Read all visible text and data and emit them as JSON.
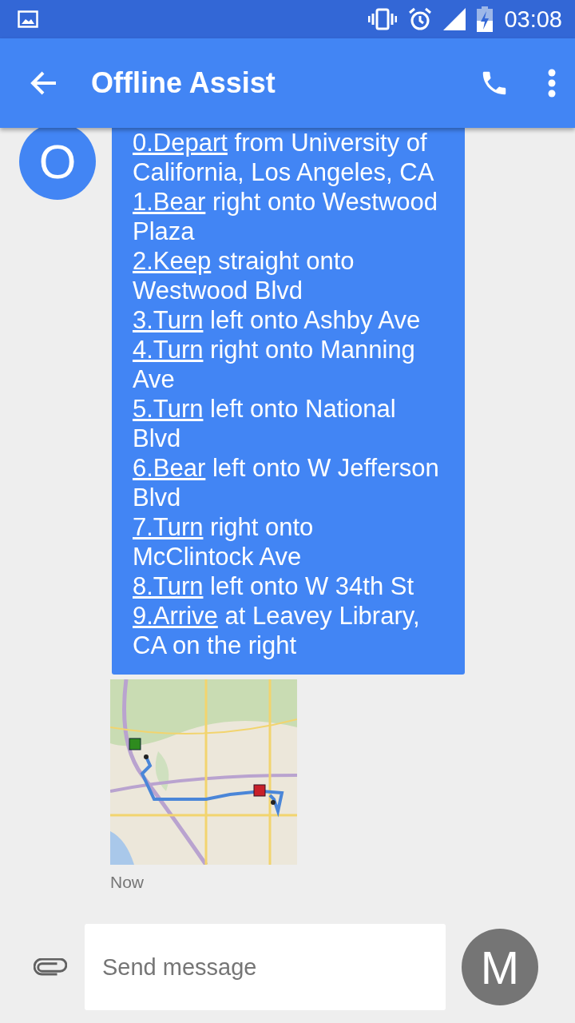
{
  "status_bar": {
    "time": "03:08"
  },
  "app_bar": {
    "title": "Offline Assist"
  },
  "messages": [
    {
      "avatar_letter": "O",
      "steps": [
        {
          "link": "0.Depart",
          "text": "from University of California, Los Angeles, CA"
        },
        {
          "link": "1.Bear",
          "text": "right onto Westwood Plaza"
        },
        {
          "link": "2.Keep",
          "text": "straight onto Westwood Blvd"
        },
        {
          "link": "3.Turn",
          "text": "left onto Ashby Ave"
        },
        {
          "link": "4.Turn",
          "text": "right onto Manning Ave"
        },
        {
          "link": "5.Turn",
          "text": "left onto National Blvd"
        },
        {
          "link": "6.Bear",
          "text": "left onto W Jefferson Blvd"
        },
        {
          "link": "7.Turn",
          "text": "right onto McClintock Ave"
        },
        {
          "link": "8.Turn",
          "text": "left onto W 34th St"
        },
        {
          "link": "9.Arrive",
          "text": "at Leavey Library, CA on the right"
        }
      ],
      "timestamp": "Now"
    }
  ],
  "composer": {
    "placeholder": "Send message",
    "avatar_letter": "M"
  }
}
